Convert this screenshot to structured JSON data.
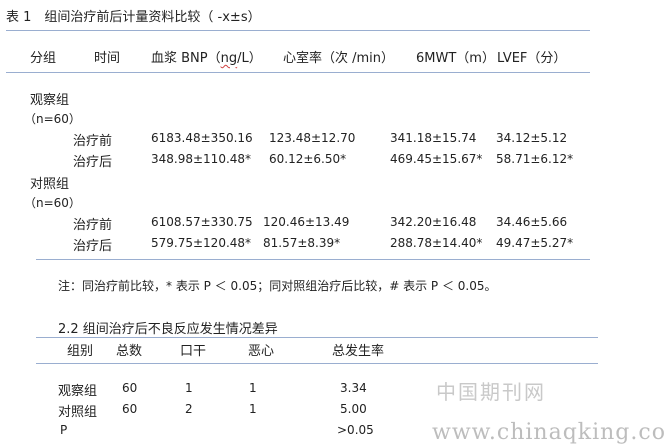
{
  "table1": {
    "title": "表 1　组间治疗前后计量资料比较（ -x±s）",
    "headers": {
      "group": "分组",
      "time": "时间",
      "bnp_prefix": "血浆 BNP（",
      "bnp_unit": "ng",
      "bnp_suffix": "/L）",
      "heart_rate": "心室率（次 /min）",
      "mwt": "6MWT（m）",
      "lvef": "LVEF（分）"
    },
    "groups": [
      {
        "name": "观察组",
        "n": "（n=60）",
        "rows": [
          {
            "time": "治疗前",
            "bnp": "6183.48±350.16",
            "hr": "123.48±12.70",
            "mwt": "341.18±15.74",
            "lvef": "34.12±5.12"
          },
          {
            "time": "治疗后",
            "bnp": "348.98±110.48*",
            "hr": "60.12±6.50*",
            "mwt": "469.45±15.67*",
            "lvef": "58.71±6.12*"
          }
        ]
      },
      {
        "name": "对照组",
        "n": "（n=60）",
        "rows": [
          {
            "time": "治疗前",
            "bnp": "6108.57±330.75",
            "hr": "120.46±13.49",
            "mwt": "342.20±16.48",
            "lvef": "34.46±5.66"
          },
          {
            "time": "治疗后",
            "bnp": "579.75±120.48*",
            "hr": "81.57±8.39*",
            "mwt": "288.78±14.40*",
            "lvef": "49.47±5.27*"
          }
        ]
      }
    ],
    "note": "注：同治疗前比较，* 表示 P ＜ 0.05；同对照组治疗后比较，# 表示 P ＜ 0.05。"
  },
  "section22": {
    "heading": "2.2 组间治疗后不良反应发生情况差异",
    "headers": {
      "group": "组别",
      "total": "总数",
      "dry_mouth": "口干",
      "nausea": "恶心",
      "rate": "总发生率"
    },
    "rows": [
      {
        "group": "观察组",
        "total": "60",
        "dry_mouth": "1",
        "nausea": "1",
        "rate": "3.34"
      },
      {
        "group": "对照组",
        "total": "60",
        "dry_mouth": "2",
        "nausea": "1",
        "rate": "5.00"
      },
      {
        "group": "P",
        "total": "",
        "dry_mouth": "",
        "nausea": "",
        "rate": ">0.05"
      }
    ]
  },
  "watermark": {
    "cn": "中国期刊网",
    "url": "www.chinaqking.com"
  }
}
